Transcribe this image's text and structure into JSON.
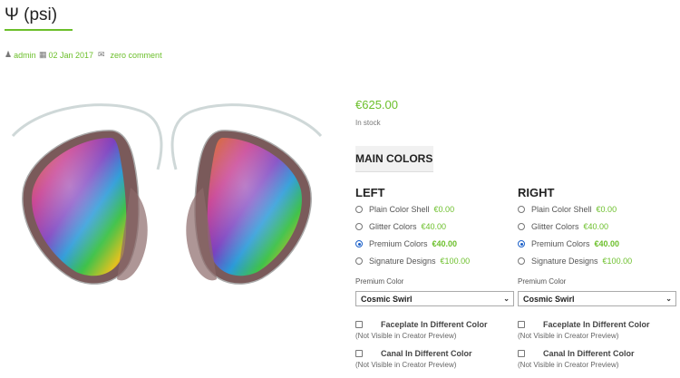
{
  "post": {
    "title": "Ψ (psi)",
    "author": "admin",
    "date": "02 Jan 2017",
    "comments": "zero comment"
  },
  "icons": {
    "author": "user-icon",
    "date": "calendar-icon",
    "comments": "comment-icon",
    "select": "chevron-down-icon"
  },
  "product": {
    "price": "€625.00",
    "stock": "In stock",
    "section_title": "MAIN COLORS"
  },
  "left": {
    "heading": "LEFT",
    "options": [
      {
        "label": "Plain Color Shell",
        "price": "€0.00",
        "checked": false
      },
      {
        "label": "Glitter Colors",
        "price": "€40.00",
        "checked": false
      },
      {
        "label": "Premium Colors",
        "price": "€40.00",
        "checked": true
      },
      {
        "label": "Signature Designs",
        "price": "€100.00",
        "checked": false
      }
    ],
    "premium_label": "Premium Color",
    "premium_value": "Cosmic Swirl",
    "faceplate_label": "Faceplate In Different Color",
    "faceplate_note": "(Not Visible in Creator Preview)",
    "canal_label": "Canal In Different Color",
    "canal_note": "(Not Visible in Creator Preview)"
  },
  "right": {
    "heading": "RIGHT",
    "options": [
      {
        "label": "Plain Color Shell",
        "price": "€0.00",
        "checked": false
      },
      {
        "label": "Glitter Colors",
        "price": "€40.00",
        "checked": false
      },
      {
        "label": "Premium Colors",
        "price": "€40.00",
        "checked": true
      },
      {
        "label": "Signature Designs",
        "price": "€100.00",
        "checked": false
      }
    ],
    "premium_label": "Premium Color",
    "premium_value": "Cosmic Swirl",
    "faceplate_label": "Faceplate In Different Color",
    "faceplate_note": "(Not Visible in Creator Preview)",
    "canal_label": "Canal In Different Color",
    "canal_note": "(Not Visible in Creator Preview)"
  },
  "colors": {
    "accent": "#6bbf2a",
    "radio_checked": "#1a5fc8"
  }
}
